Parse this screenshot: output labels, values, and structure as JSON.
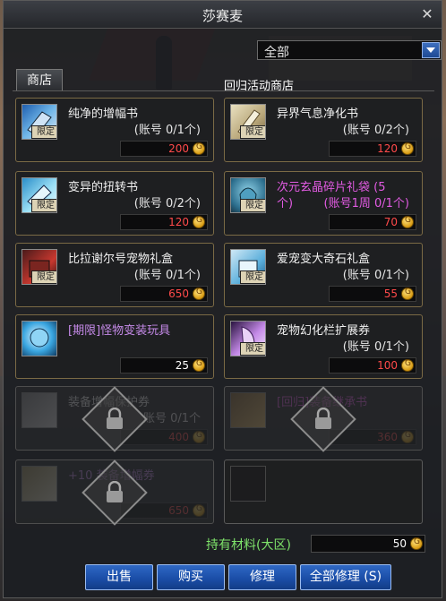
{
  "window": {
    "title": "莎赛麦",
    "close_icon": "close-icon"
  },
  "filter": {
    "selected": "全部"
  },
  "tabs": [
    {
      "label": "商店"
    }
  ],
  "shop_name": "回归活动商店",
  "items": [
    {
      "name": "纯净的增幅书",
      "limit": "(账号 0/1个)",
      "price": "200",
      "tag": "限定",
      "icon": "amplify-book-icon",
      "locked": false
    },
    {
      "name": "异界气息净化书",
      "limit": "(账号 0/2个)",
      "price": "120",
      "tag": "限定",
      "icon": "purify-book-icon",
      "locked": false
    },
    {
      "name": "变异的扭转书",
      "limit": "(账号 0/2个)",
      "price": "120",
      "tag": "限定",
      "icon": "twist-book-icon",
      "locked": false
    },
    {
      "name_line1": "次元玄晶碎片礼袋 (5",
      "name_line2": "个)",
      "limit": "(账号1周 0/1个)",
      "price": "70",
      "tag": "限定",
      "icon": "crystal-bag-icon",
      "locked": false,
      "color": "pink"
    },
    {
      "name": "比拉谢尔号宠物礼盒",
      "limit": "(账号 0/1个)",
      "price": "650",
      "tag": "限定",
      "icon": "pet-box-icon",
      "locked": false
    },
    {
      "name": "爱宠变大奇石礼盒",
      "limit": "(账号 0/1个)",
      "price": "55",
      "tag": "限定",
      "icon": "stone-box-icon",
      "locked": false
    },
    {
      "name": "[期限]怪物变装玩具",
      "limit": "",
      "price": "25",
      "tag": "",
      "icon": "monster-toy-icon",
      "locked": false
    },
    {
      "name": "宠物幻化栏扩展券",
      "limit": "(账号 0/1个)",
      "price": "100",
      "tag": "限定",
      "icon": "pet-ticket-icon",
      "locked": false
    },
    {
      "name": "装备增幅保护券",
      "limit": "账号 0/1个",
      "price": "400",
      "tag": "",
      "icon": "protect-ticket-icon",
      "locked": true
    },
    {
      "name": "[回归]装备继承书",
      "limit": "",
      "price": "360",
      "tag": "",
      "icon": "inherit-book-icon",
      "locked": true,
      "color": "pink"
    },
    {
      "name": "+10 装备增幅券",
      "limit": "",
      "price": "650",
      "tag": "",
      "icon": "plus10-ticket-icon",
      "locked": true
    },
    {
      "name": "",
      "limit": "",
      "price": "",
      "tag": "",
      "icon": "",
      "locked": false
    }
  ],
  "material": {
    "label": "持有材料(大区)",
    "value": "50"
  },
  "buttons": {
    "sell": "出售",
    "buy": "购买",
    "repair": "修理",
    "repair_all": "全部修理 (S)"
  },
  "colors": {
    "accent_blue": "#1b4ea8",
    "price_red": "#ff4a4a",
    "limited_pink": "#e25be3",
    "material_green": "#7ee36a"
  }
}
